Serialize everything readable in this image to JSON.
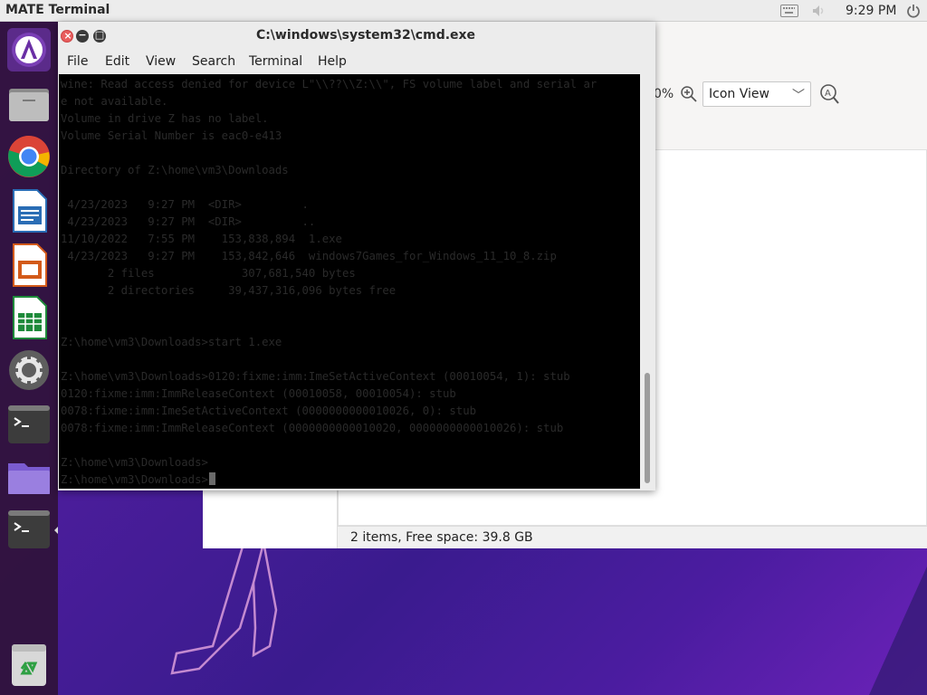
{
  "top_panel": {
    "app_title": "MATE Terminal",
    "clock": "9:29 PM"
  },
  "dock": {
    "items": [
      {
        "name": "app-launcher",
        "icon": "arch-launcher-icon"
      },
      {
        "name": "files",
        "icon": "file-manager-icon"
      },
      {
        "name": "chrome",
        "icon": "chrome-icon"
      },
      {
        "name": "writer",
        "icon": "libreoffice-writer-icon"
      },
      {
        "name": "impress",
        "icon": "libreoffice-impress-icon"
      },
      {
        "name": "calc",
        "icon": "libreoffice-calc-icon"
      },
      {
        "name": "settings",
        "icon": "settings-gear-icon"
      },
      {
        "name": "terminal",
        "icon": "terminal-icon"
      },
      {
        "name": "folder",
        "icon": "folder-icon"
      },
      {
        "name": "terminal-2",
        "icon": "terminal-icon"
      },
      {
        "name": "trash",
        "icon": "trash-icon"
      }
    ]
  },
  "file_manager": {
    "zoom": "0%",
    "view_mode": "Icon View",
    "status": "2 items, Free space: 39.8 GB"
  },
  "terminal": {
    "title": "C:\\windows\\system32\\cmd.exe",
    "menu": [
      "File",
      "Edit",
      "View",
      "Search",
      "Terminal",
      "Help"
    ],
    "lines": [
      "wine: Read access denied for device L\"\\\\??\\\\Z:\\\\\", FS volume label and serial ar",
      "e not available.",
      "Volume in drive Z has no label.",
      "Volume Serial Number is eac0-e413",
      "",
      "Directory of Z:\\home\\vm3\\Downloads",
      "",
      " 4/23/2023   9:27 PM  <DIR>         .",
      " 4/23/2023   9:27 PM  <DIR>         ..",
      "11/10/2022   7:55 PM    153,838,894  1.exe",
      " 4/23/2023   9:27 PM    153,842,646  windows7Games_for_Windows_11_10_8.zip",
      "       2 files             307,681,540 bytes",
      "       2 directories     39,437,316,096 bytes free",
      "",
      "",
      "Z:\\home\\vm3\\Downloads>start 1.exe",
      "",
      "Z:\\home\\vm3\\Downloads>0120:fixme:imm:ImeSetActiveContext (00010054, 1): stub",
      "0120:fixme:imm:ImmReleaseContext (00010058, 00010054): stub",
      "0078:fixme:imm:ImeSetActiveContext (0000000000010026, 0): stub",
      "0078:fixme:imm:ImmReleaseContext (0000000000010020, 0000000000010026): stub",
      "",
      "Z:\\home\\vm3\\Downloads>",
      "Z:\\home\\vm3\\Downloads>"
    ]
  }
}
